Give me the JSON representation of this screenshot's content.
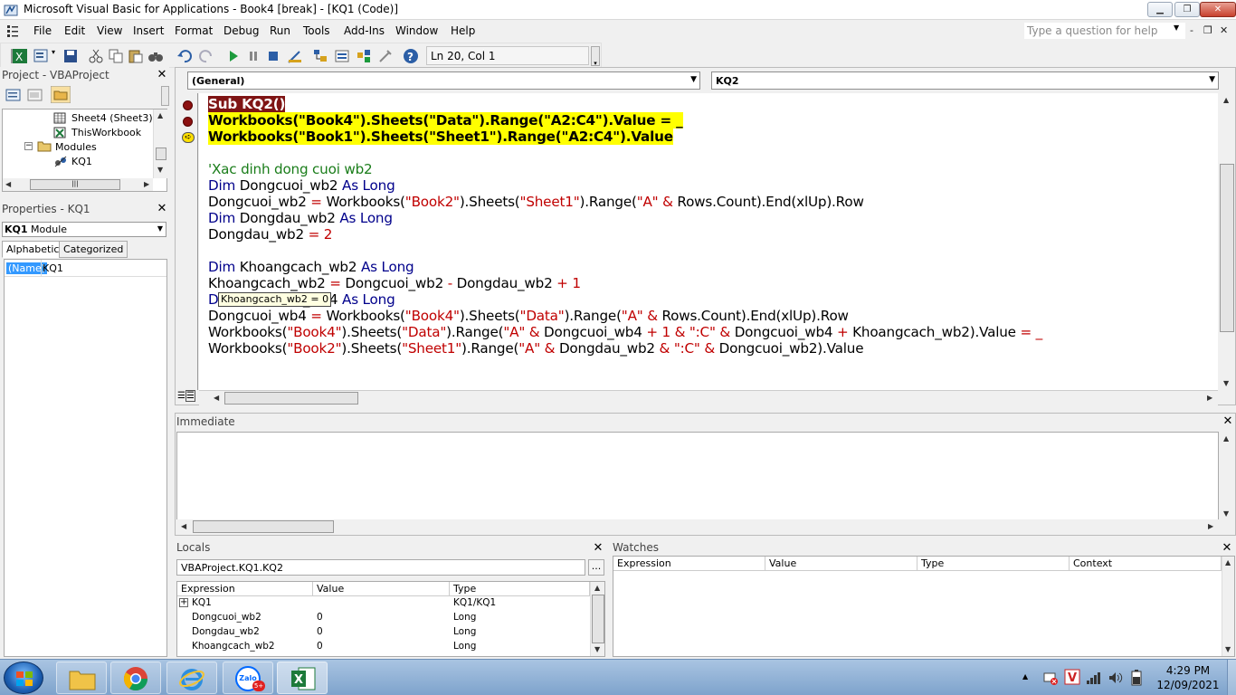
{
  "window": {
    "title": "Microsoft Visual Basic for Applications - Book4 [break] - [KQ1 (Code)]",
    "controls": {
      "minimize": "▁",
      "restore": "❐",
      "close": "✕"
    }
  },
  "menubar": {
    "items": [
      "File",
      "Edit",
      "View",
      "Insert",
      "Format",
      "Debug",
      "Run",
      "Tools",
      "Add-Ins",
      "Window",
      "Help"
    ],
    "help_placeholder": "Type a question for help",
    "mdi_controls": {
      "minimize": "-",
      "restore": "❐",
      "close": "✕"
    }
  },
  "toolbar": {
    "position": "Ln 20, Col 1"
  },
  "project": {
    "title": "Project - VBAProject",
    "tree": [
      "Sheet4 (Sheet3)",
      "ThisWorkbook",
      "Modules",
      "KQ1"
    ]
  },
  "properties": {
    "title": "Properties - KQ1",
    "object_name": "KQ1",
    "object_type": "Module",
    "tabs": [
      "Alphabetic",
      "Categorized"
    ],
    "rows": [
      {
        "name": "(Name)",
        "value": "KQ1"
      }
    ]
  },
  "code": {
    "object_combo": "(General)",
    "proc_combo": "KQ2",
    "tooltip": "Khoangcach_wb2 = 0"
  },
  "immediate": {
    "title": "Immediate"
  },
  "locals": {
    "title": "Locals",
    "context": "VBAProject.KQ1.KQ2",
    "dots": "...",
    "columns": [
      "Expression",
      "Value",
      "Type"
    ],
    "rows": [
      {
        "expression": "KQ1",
        "value": "",
        "type": "KQ1/KQ1"
      },
      {
        "expression": "Dongcuoi_wb2",
        "value": "0",
        "type": "Long"
      },
      {
        "expression": "Dongdau_wb2",
        "value": "0",
        "type": "Long"
      },
      {
        "expression": "Khoangcach_wb2",
        "value": "0",
        "type": "Long"
      }
    ]
  },
  "watches": {
    "title": "Watches",
    "columns": [
      "Expression",
      "Value",
      "Type",
      "Context"
    ]
  },
  "taskbar": {
    "time": "4:29 PM",
    "date": "12/09/2021",
    "zalo_label": "Zalo",
    "zalo_badge": "5+"
  },
  "colors": {
    "keyword": "#00008b",
    "string": "#c00000",
    "comment": "#1a7d1a",
    "highlight": "#ffff00",
    "breakpoint": "#7f1414"
  }
}
